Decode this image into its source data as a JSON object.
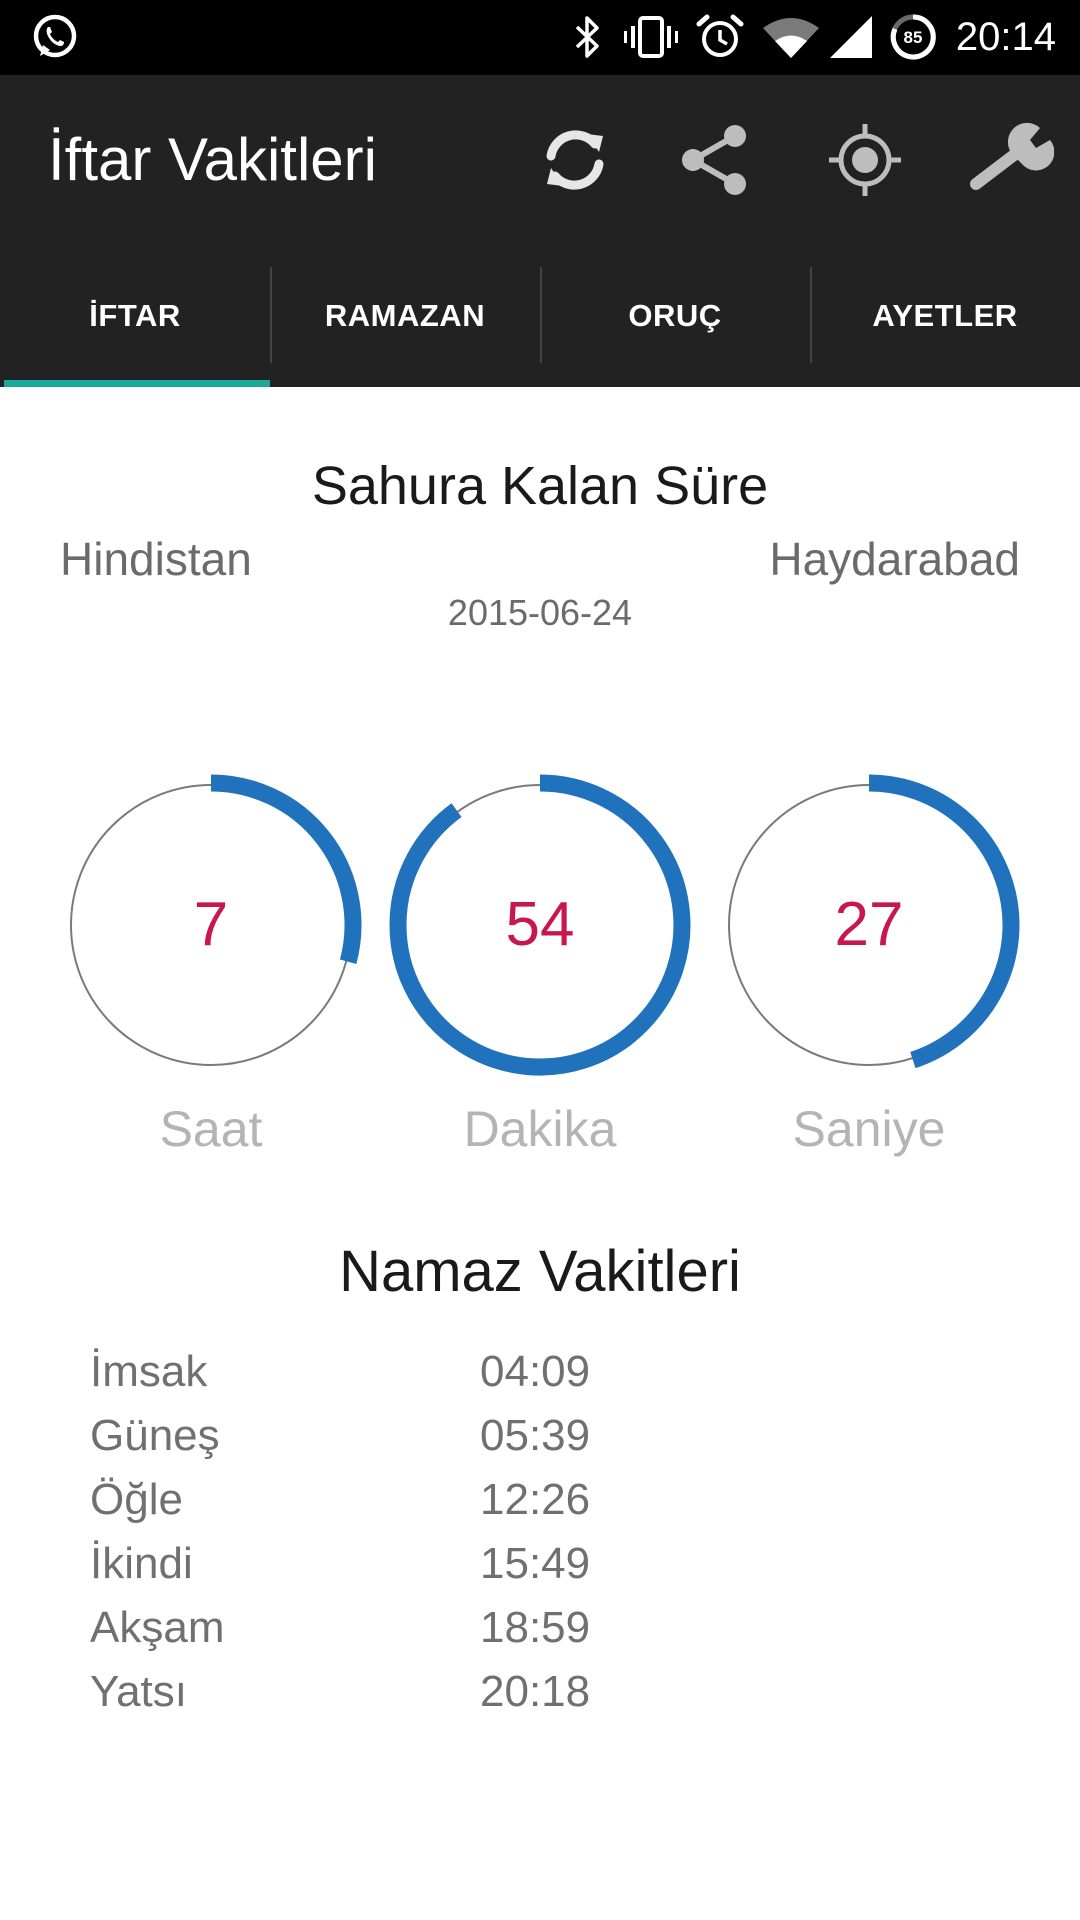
{
  "status_bar": {
    "clock": "20:14",
    "battery_level": "85",
    "icons": [
      "whatsapp-icon",
      "bluetooth-icon",
      "vibrate-icon",
      "alarm-icon",
      "wifi-icon",
      "cell-signal-icon",
      "battery-icon"
    ]
  },
  "app_bar": {
    "title": "İftar Vakitleri",
    "actions": [
      "refresh-icon",
      "share-icon",
      "location-icon",
      "settings-wrench-icon"
    ]
  },
  "tabs": [
    {
      "label": "İFTAR",
      "active": true
    },
    {
      "label": "RAMAZAN",
      "active": false
    },
    {
      "label": "ORUÇ",
      "active": false
    },
    {
      "label": "AYETLER",
      "active": false
    }
  ],
  "countdown": {
    "title": "Sahura Kalan Süre",
    "country": "Hindistan",
    "city": "Haydarabad",
    "date": "2015-06-24",
    "units": [
      {
        "value": "7",
        "label": "Saat",
        "max": 24
      },
      {
        "value": "54",
        "label": "Dakika",
        "max": 60
      },
      {
        "value": "27",
        "label": "Saniye",
        "max": 60
      }
    ]
  },
  "prayer_times": {
    "title": "Namaz Vakitleri",
    "rows": [
      {
        "name": "İmsak",
        "time": "04:09"
      },
      {
        "name": "Güneş",
        "time": "05:39"
      },
      {
        "name": "Öğle",
        "time": "12:26"
      },
      {
        "name": "İkindi",
        "time": "15:49"
      },
      {
        "name": "Akşam",
        "time": "18:59"
      },
      {
        "name": "Yatsı",
        "time": "20:18"
      }
    ]
  },
  "colors": {
    "bar_bg": "#222222",
    "tab_indicator": "#1aa89a",
    "progress_arc": "#1f72bb",
    "dial_number": "#c8174a"
  }
}
